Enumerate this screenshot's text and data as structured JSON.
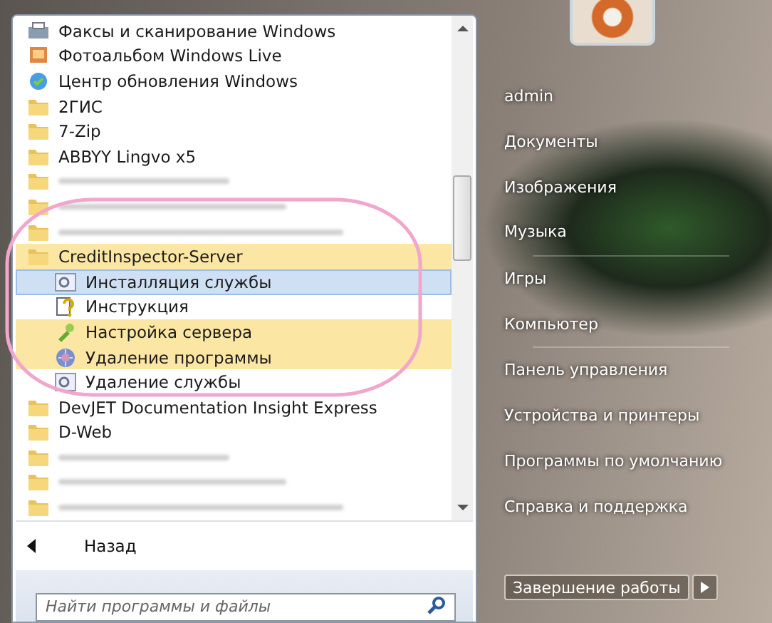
{
  "programs": [
    {
      "kind": "fax",
      "label": "Факсы и сканирование Windows",
      "obscured": false,
      "new": false
    },
    {
      "kind": "photo",
      "label": "Фотоальбом Windows Live",
      "obscured": false,
      "new": false
    },
    {
      "kind": "update",
      "label": "Центр обновления Windows",
      "obscured": false,
      "new": false
    },
    {
      "kind": "folder",
      "label": "2ГИС",
      "obscured": false,
      "new": false
    },
    {
      "kind": "folder",
      "label": "7-Zip",
      "obscured": false,
      "new": false
    },
    {
      "kind": "folder",
      "label": "ABBYY Lingvo x5",
      "obscured": false,
      "new": false
    },
    {
      "kind": "folder",
      "obscured": true,
      "new": false
    },
    {
      "kind": "folder",
      "obscured": true,
      "new": false
    },
    {
      "kind": "folder",
      "obscured": true,
      "new": false
    },
    {
      "kind": "folder",
      "label": "CreditInspector-Server",
      "obscured": false,
      "new": true,
      "expanded": true,
      "children": [
        {
          "kind": "service",
          "label": "Инсталляция службы",
          "selected": true,
          "new": false
        },
        {
          "kind": "help",
          "label": "Инструкция",
          "selected": false,
          "new": false
        },
        {
          "kind": "setup",
          "label": "Настройка сервера",
          "selected": false,
          "new": true
        },
        {
          "kind": "uninstall",
          "label": "Удаление программы",
          "selected": false,
          "new": true
        },
        {
          "kind": "service",
          "label": "Удаление службы",
          "selected": false,
          "new": false
        }
      ]
    },
    {
      "kind": "folder",
      "label": "DevJET Documentation Insight Express",
      "obscured": false,
      "new": false
    },
    {
      "kind": "folder",
      "label": "D-Web",
      "obscured": false,
      "new": false
    },
    {
      "kind": "folder",
      "obscured": true,
      "new": false
    },
    {
      "kind": "folder",
      "obscured": true,
      "new": false
    },
    {
      "kind": "folder",
      "obscured": true,
      "new": false
    }
  ],
  "back": {
    "label": "Назад"
  },
  "search": {
    "placeholder": "Найти программы и файлы"
  },
  "annotation": {
    "color": "#f2a6cc"
  },
  "places": [
    [
      "admin",
      "Документы",
      "Изображения",
      "Музыка"
    ],
    [
      "Игры",
      "Компьютер"
    ],
    [
      "Панель управления",
      "Устройства и принтеры",
      "Программы по умолчанию",
      "Справка и поддержка"
    ]
  ],
  "shutdown": {
    "label": "Завершение работы"
  }
}
